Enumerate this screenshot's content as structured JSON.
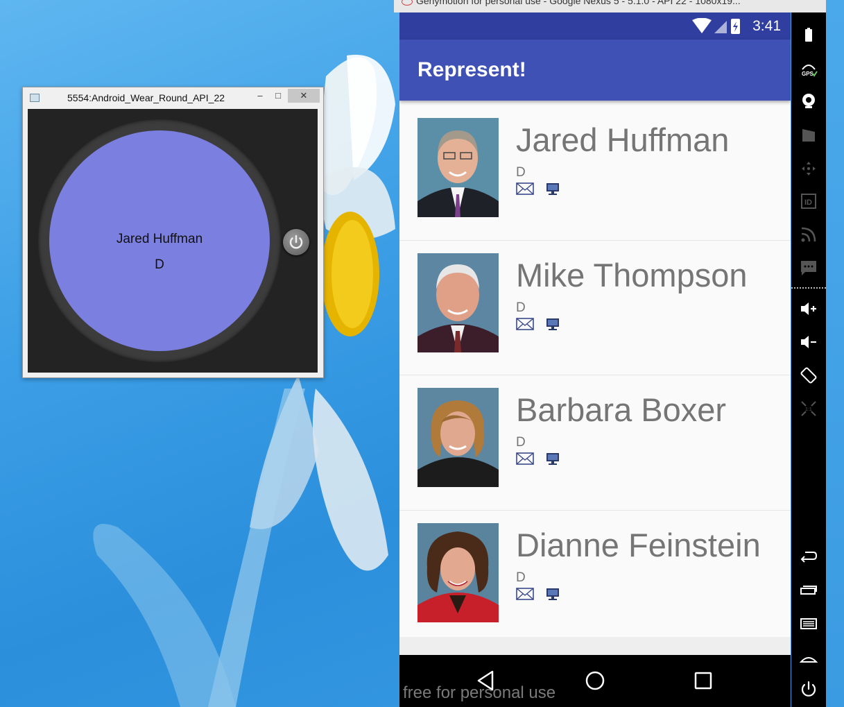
{
  "wear_window": {
    "title": "5554:Android_Wear_Round_API_22",
    "minimize": "–",
    "maximize": "□",
    "close": "✕",
    "watch_name": "Jared Huffman",
    "watch_party": "D"
  },
  "genymotion": {
    "title": "Genymotion for personal use - Google Nexus 5 - 5.1.0 - API 22 - 1080x19...",
    "status_time": "3:41",
    "app_title": "Represent!",
    "representatives": [
      {
        "name": "Jared Huffman",
        "party": "D"
      },
      {
        "name": "Mike Thompson",
        "party": "D"
      },
      {
        "name": "Barbara Boxer",
        "party": "D"
      },
      {
        "name": "Dianne Feinstein",
        "party": "D"
      }
    ],
    "watermark": "free for personal use"
  },
  "sidebar_icons": [
    "battery-icon",
    "gps-icon",
    "camera-icon",
    "video-icon",
    "dpad-icon",
    "id-icon",
    "rss-icon",
    "sms-icon",
    "volume-up-icon",
    "volume-down-icon",
    "rotate-icon",
    "pixel-perfect-icon",
    "back-icon",
    "recent-apps-icon",
    "menu-icon",
    "home-icon",
    "power-icon"
  ]
}
